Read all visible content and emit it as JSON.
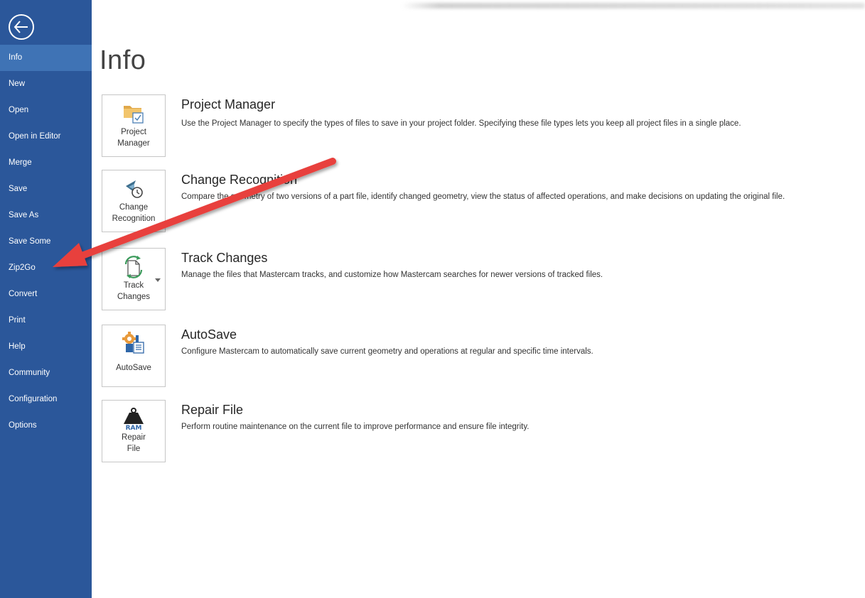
{
  "sidebar": {
    "back_icon": "back-arrow-circle-icon",
    "items": [
      {
        "label": "Info",
        "active": true
      },
      {
        "label": "New"
      },
      {
        "label": "Open"
      },
      {
        "label": "Open in Editor"
      },
      {
        "label": "Merge"
      },
      {
        "label": "Save"
      },
      {
        "label": "Save As"
      },
      {
        "label": "Save Some"
      },
      {
        "label": "Zip2Go"
      },
      {
        "label": "Convert"
      },
      {
        "label": "Print"
      },
      {
        "label": "Help"
      },
      {
        "label": "Community"
      },
      {
        "label": "Configuration"
      },
      {
        "label": "Options"
      }
    ],
    "bg_color": "#2b579a",
    "active_color": "#3f73b5"
  },
  "main": {
    "title": "Info",
    "items": [
      {
        "tile_label": "Project\nManager",
        "icon": "folder-checklist-icon",
        "title": "Project Manager",
        "description": "Use the Project Manager to specify the types of files to save in your project folder. Specifying these file types lets you keep all project files in a single place."
      },
      {
        "tile_label": "Change\nRecognition",
        "icon": "change-recognition-icon",
        "title": "Change Recognition",
        "description": "Compare the geometry of two versions of a part file, identify changed geometry, view the status of affected operations, and make decisions on updating the original file."
      },
      {
        "tile_label": "Track\nChanges",
        "icon": "track-changes-icon",
        "title": "Track Changes",
        "description": "Manage the files that Mastercam tracks, and customize how Mastercam searches for newer versions of tracked files."
      },
      {
        "tile_label": "AutoSave",
        "icon": "autosave-gear-icon",
        "title": "AutoSave",
        "description": "Configure Mastercam to automatically save current geometry and operations at regular and specific time intervals."
      },
      {
        "tile_label": "Repair\nFile",
        "icon": "ram-weight-icon",
        "icon_text": "RAM",
        "title": "Repair File",
        "description": "Perform routine maintenance on the current file to improve performance and ensure file integrity."
      }
    ]
  },
  "annotation": {
    "arrow_color": "#e8403c",
    "points_to": "Zip2Go"
  }
}
